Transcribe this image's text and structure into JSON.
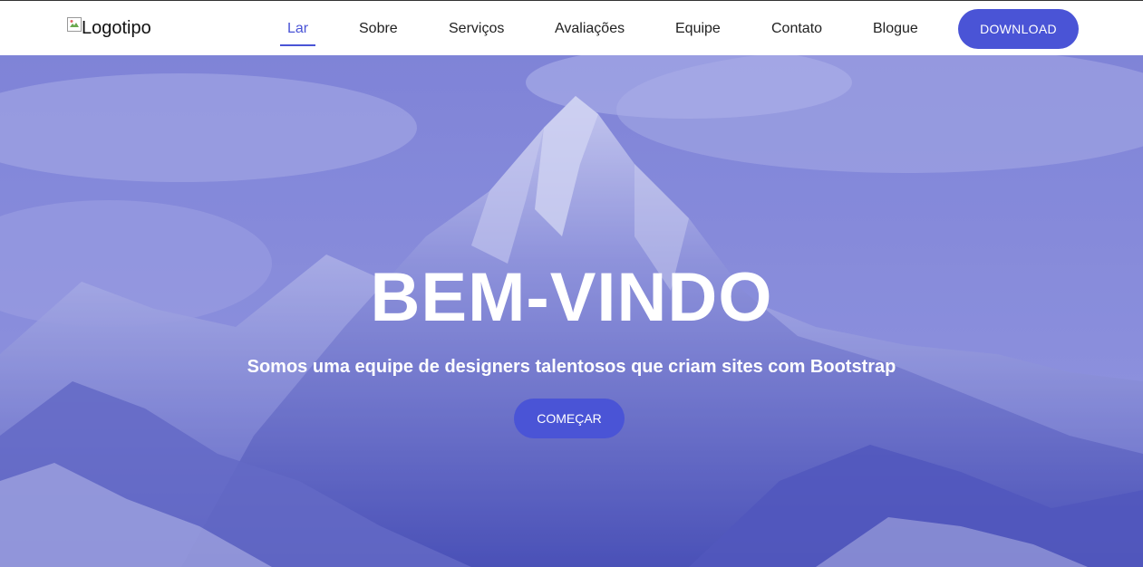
{
  "header": {
    "logo_alt": "Logotipo",
    "nav": [
      {
        "label": "Lar",
        "active": true
      },
      {
        "label": "Sobre"
      },
      {
        "label": "Serviços"
      },
      {
        "label": "Avaliações"
      },
      {
        "label": "Equipe"
      },
      {
        "label": "Contato"
      },
      {
        "label": "Blogue"
      }
    ],
    "download_label": "DOWNLOAD"
  },
  "hero": {
    "title": "BEM-VINDO",
    "subtitle": "Somos uma equipe de designers talentosos que criam sites com Bootstrap",
    "cta_label": "COMEÇAR",
    "background": "mountain-photo"
  },
  "colors": {
    "accent": "#4a54d6",
    "hero_tint": "#8f93dc"
  }
}
